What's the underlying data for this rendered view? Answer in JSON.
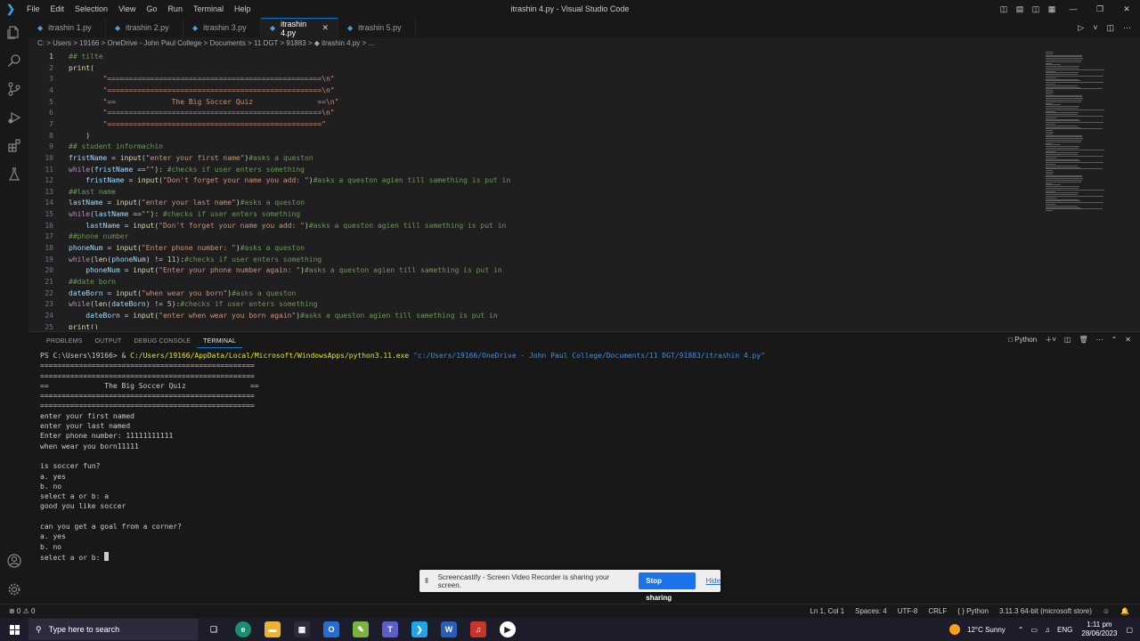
{
  "window": {
    "title": "itrashin 4.py - Visual Studio Code",
    "menu": [
      "File",
      "Edit",
      "Selection",
      "View",
      "Go",
      "Run",
      "Terminal",
      "Help"
    ]
  },
  "tabs": [
    {
      "label": "itrashin 1.py",
      "active": false
    },
    {
      "label": "itrashin 2.py",
      "active": false
    },
    {
      "label": "itrashin 3.py",
      "active": false
    },
    {
      "label": "itrashin 4.py",
      "active": true
    },
    {
      "label": "itrashin 5.py",
      "active": false
    }
  ],
  "breadcrumb": "C: > Users > 19166 > OneDrive - John Paul College > Documents > 11 DGT > 91883 > ◆ itrashin 4.py > ...",
  "editor": {
    "lines": [
      {
        "n": "1",
        "segments": [
          [
            "cm",
            "## tilte"
          ]
        ]
      },
      {
        "n": "2",
        "segments": [
          [
            "fn",
            "print"
          ],
          [
            "",
            "("
          ]
        ]
      },
      {
        "n": "3",
        "segments": [
          [
            "",
            "        "
          ],
          [
            "str",
            "\"==================================================\\n\""
          ]
        ]
      },
      {
        "n": "4",
        "segments": [
          [
            "",
            "        "
          ],
          [
            "str",
            "\"==================================================\\n\""
          ]
        ]
      },
      {
        "n": "5",
        "segments": [
          [
            "",
            "        "
          ],
          [
            "str",
            "\"==             The Big Soccer Quiz               ==\\n\""
          ]
        ]
      },
      {
        "n": "6",
        "segments": [
          [
            "",
            "        "
          ],
          [
            "str",
            "\"==================================================\\n\""
          ]
        ]
      },
      {
        "n": "7",
        "segments": [
          [
            "",
            "        "
          ],
          [
            "str",
            "\"==================================================\""
          ]
        ]
      },
      {
        "n": "8",
        "segments": [
          [
            "",
            "    )"
          ]
        ]
      },
      {
        "n": "9",
        "segments": [
          [
            "cm",
            "## student informachin"
          ]
        ]
      },
      {
        "n": "10",
        "segments": [
          [
            "var",
            "fristName"
          ],
          [
            "",
            " = "
          ],
          [
            "fn",
            "input"
          ],
          [
            "",
            "("
          ],
          [
            "str",
            "\"enter your first name\""
          ],
          [
            "",
            ")"
          ],
          [
            "cm",
            "#asks a queston"
          ]
        ]
      },
      {
        "n": "11",
        "segments": [
          [
            "kw",
            "while"
          ],
          [
            "",
            "("
          ],
          [
            "var",
            "fristName"
          ],
          [
            "",
            " =="
          ],
          [
            "str",
            "\"\""
          ],
          [
            "",
            "): "
          ],
          [
            "cm",
            "#checks if user enters something"
          ]
        ]
      },
      {
        "n": "12",
        "segments": [
          [
            "",
            "    "
          ],
          [
            "var",
            "fristName"
          ],
          [
            "",
            " = "
          ],
          [
            "fn",
            "input"
          ],
          [
            "",
            "("
          ],
          [
            "str",
            "\"Don't forget your name you add: \""
          ],
          [
            "",
            ")"
          ],
          [
            "cm",
            "#asks a queston agien till samething is put in"
          ]
        ]
      },
      {
        "n": "13",
        "segments": [
          [
            "cm",
            "##last name"
          ]
        ]
      },
      {
        "n": "14",
        "segments": [
          [
            "var",
            "lastName"
          ],
          [
            "",
            " = "
          ],
          [
            "fn",
            "input"
          ],
          [
            "",
            "("
          ],
          [
            "str",
            "\"enter your last name\""
          ],
          [
            "",
            ")"
          ],
          [
            "cm",
            "#asks a queston"
          ]
        ]
      },
      {
        "n": "15",
        "segments": [
          [
            "kw",
            "while"
          ],
          [
            "",
            "("
          ],
          [
            "var",
            "lastName"
          ],
          [
            "",
            " =="
          ],
          [
            "str",
            "\"\""
          ],
          [
            "",
            "): "
          ],
          [
            "cm",
            "#checks if user enters something"
          ]
        ]
      },
      {
        "n": "16",
        "segments": [
          [
            "",
            "    "
          ],
          [
            "var",
            "lastName"
          ],
          [
            "",
            " = "
          ],
          [
            "fn",
            "input"
          ],
          [
            "",
            "("
          ],
          [
            "str",
            "\"Don't forget your name you add: \""
          ],
          [
            "",
            ")"
          ],
          [
            "cm",
            "#asks a queston agien till samething is put in"
          ]
        ]
      },
      {
        "n": "17",
        "segments": [
          [
            "cm",
            "##phone number"
          ]
        ]
      },
      {
        "n": "18",
        "segments": [
          [
            "var",
            "phoneNum"
          ],
          [
            "",
            " = "
          ],
          [
            "fn",
            "input"
          ],
          [
            "",
            "("
          ],
          [
            "str",
            "\"Enter phone number: \""
          ],
          [
            "",
            ")"
          ],
          [
            "cm",
            "#asks a queston"
          ]
        ]
      },
      {
        "n": "19",
        "segments": [
          [
            "kw",
            "while"
          ],
          [
            "",
            "("
          ],
          [
            "fn",
            "len"
          ],
          [
            "",
            "("
          ],
          [
            "var",
            "phoneNum"
          ],
          [
            "",
            ") != "
          ],
          [
            "num",
            "11"
          ],
          [
            "",
            "):"
          ],
          [
            "cm",
            "#checks if user enters something"
          ]
        ]
      },
      {
        "n": "20",
        "segments": [
          [
            "",
            "    "
          ],
          [
            "var",
            "phoneNum"
          ],
          [
            "",
            " = "
          ],
          [
            "fn",
            "input"
          ],
          [
            "",
            "("
          ],
          [
            "str",
            "\"Enter your phone number again: \""
          ],
          [
            "",
            ")"
          ],
          [
            "cm",
            "#asks a queston agien till samething is put in"
          ]
        ]
      },
      {
        "n": "21",
        "segments": [
          [
            "cm",
            "##date born"
          ]
        ]
      },
      {
        "n": "22",
        "segments": [
          [
            "var",
            "dateBorn"
          ],
          [
            "",
            " = "
          ],
          [
            "fn",
            "input"
          ],
          [
            "",
            "("
          ],
          [
            "str",
            "\"when wear you born\""
          ],
          [
            "",
            ")"
          ],
          [
            "cm",
            "#asks a queston"
          ]
        ]
      },
      {
        "n": "23",
        "segments": [
          [
            "kw",
            "while"
          ],
          [
            "",
            "("
          ],
          [
            "fn",
            "len"
          ],
          [
            "",
            "("
          ],
          [
            "var",
            "dateBorn"
          ],
          [
            "",
            ") != "
          ],
          [
            "num",
            "5"
          ],
          [
            "",
            "):"
          ],
          [
            "cm",
            "#checks if user enters something"
          ]
        ]
      },
      {
        "n": "24",
        "segments": [
          [
            "",
            "    "
          ],
          [
            "var",
            "dateBorn"
          ],
          [
            "",
            " = "
          ],
          [
            "fn",
            "input"
          ],
          [
            "",
            "("
          ],
          [
            "str",
            "\"enter when wear you born again\""
          ],
          [
            "",
            ")"
          ],
          [
            "cm",
            "#asks a queston agien till samething is put in"
          ]
        ]
      },
      {
        "n": "25",
        "segments": [
          [
            "fn",
            "print"
          ],
          [
            "",
            "()"
          ]
        ]
      }
    ]
  },
  "panel": {
    "tabs": [
      "PROBLEMS",
      "OUTPUT",
      "DEBUG CONSOLE",
      "TERMINAL"
    ],
    "active_tab": "TERMINAL",
    "shell_label": "Python",
    "terminal": {
      "prompt": "PS C:\\Users\\19166> & ",
      "exe": "C:/Users/19166/AppData/Local/Microsoft/WindowsApps/python3.11.exe",
      "script": "\"c:/Users/19166/OneDrive - John Paul College/Documents/11 DGT/91883/itrashin 4.py\"",
      "output": [
        "==================================================",
        "==================================================",
        "==             The Big Soccer Quiz               ==",
        "==================================================",
        "==================================================",
        "enter your first named",
        "enter your last named",
        "Enter phone number: 11111111111",
        "when wear you born11111",
        "",
        "is soccer fun?",
        "a. yes",
        "b. no",
        "select a or b: a",
        "good you like soccer",
        "",
        "can you get a goal from a corner?",
        "a. yes",
        "b. no"
      ],
      "last_prompt": "select a or b: "
    }
  },
  "notification": {
    "message": "Screencastify - Screen Video Recorder is sharing your screen.",
    "stop_label": "Stop sharing",
    "hide_label": "Hide"
  },
  "status": {
    "problems": "⊗ 0 ⚠ 0",
    "position": "Ln 1, Col 1",
    "spaces": "Spaces: 4",
    "encoding": "UTF-8",
    "eol": "CRLF",
    "language": "Python",
    "interpreter": "3.11.3 64-bit (microsoft store)"
  },
  "taskbar": {
    "search_placeholder": "Type here to search",
    "weather": "12°C  Sunny",
    "lang": "ENG",
    "time": "1:11 pm",
    "date": "28/06/2023"
  }
}
